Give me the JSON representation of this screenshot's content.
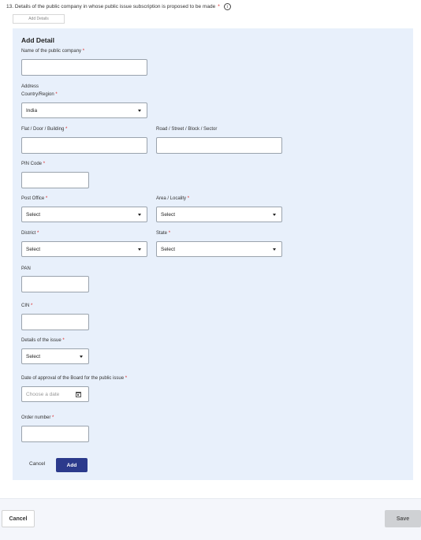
{
  "question": {
    "title": "13. Details of the public company in whose public issue subscription is proposed to be made",
    "required_mark": "*",
    "info_icon": "info-circle-icon"
  },
  "add_details_button": "Add Details",
  "panel": {
    "title": "Add Detail",
    "required_mark": "*",
    "company_name_label": "Name of the public company",
    "address_heading": "Address",
    "country_label": "Country/Region",
    "country_value": "India",
    "flat_label": "Flat / Door / Building",
    "road_label": "Road / Street / Block / Sector",
    "pin_label": "PIN Code",
    "post_office_label": "Post Office",
    "post_office_value": "Select",
    "area_label": "Area / Locality",
    "area_value": "Select",
    "district_label": "District",
    "district_value": "Select",
    "state_label": "State",
    "state_value": "Select",
    "pan_label": "PAN",
    "cin_label": "CIN",
    "issue_label": "Details of the issue",
    "issue_value": "Select",
    "approval_date_label": "Date of approval of the Board for the public issue",
    "approval_date_placeholder": "Choose a date",
    "order_number_label": "Order number",
    "cancel_label": "Cancel",
    "add_label": "Add"
  },
  "footer": {
    "cancel_label": "Cancel",
    "save_label": "Save"
  }
}
